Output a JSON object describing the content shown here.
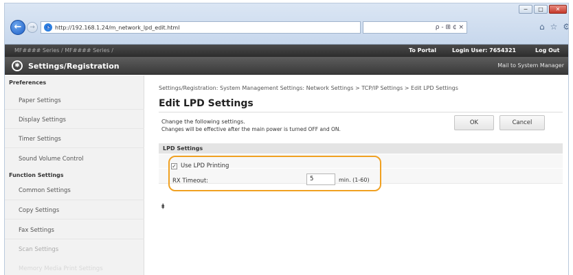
{
  "browser": {
    "url": "http://192.168.1.24/m_network_lpd_edit.html",
    "search_tools": "ρ - ⊞ ¢ ×",
    "window_controls": [
      "−",
      "□",
      "✕"
    ],
    "nav_icons": {
      "back": "back-arrow-icon",
      "forward": "forward-arrow-icon",
      "home": "home-icon",
      "favorites": "star-icon",
      "settings": "gear-icon"
    }
  },
  "header": {
    "model": "MF####  Series / MF#### Series /",
    "to_portal": "To Portal",
    "login_user": "Login User:  7654321",
    "log_out": "Log Out",
    "app_title": "Settings/Registration",
    "mail_link": "Mail to System Manager"
  },
  "sidebar": {
    "preferences_head": "Preferences",
    "preferences": [
      "Paper Settings",
      "Display Settings",
      "Timer Settings",
      "Sound Volume Control"
    ],
    "function_head": "Function Settings",
    "function": [
      "Common Settings",
      "Copy Settings",
      "Fax Settings",
      "Scan Settings",
      "Memory Media Print Settings"
    ]
  },
  "main": {
    "breadcrumb": "Settings/Registration: System Management Settings: Network Settings > TCP/IP Settings > Edit LPD Settings",
    "title": "Edit LPD Settings",
    "desc1": "Change the following settings.",
    "desc2": "Changes will be effective after the main power is turned OFF and ON.",
    "ok_label": "OK",
    "cancel_label": "Cancel",
    "section_title": "LPD Settings",
    "use_lpd_label": "Use LPD Printing",
    "use_lpd_checked": "✓",
    "rx_timeout_label": "RX Timeout:",
    "rx_timeout_value": "5",
    "rx_timeout_unit": "min. (1-60)",
    "top_link": "⯒"
  },
  "colors": {
    "highlight": "#f0a020",
    "header_dark": "#3a3a3a",
    "sidebar_bg": "#f2f2f2"
  }
}
